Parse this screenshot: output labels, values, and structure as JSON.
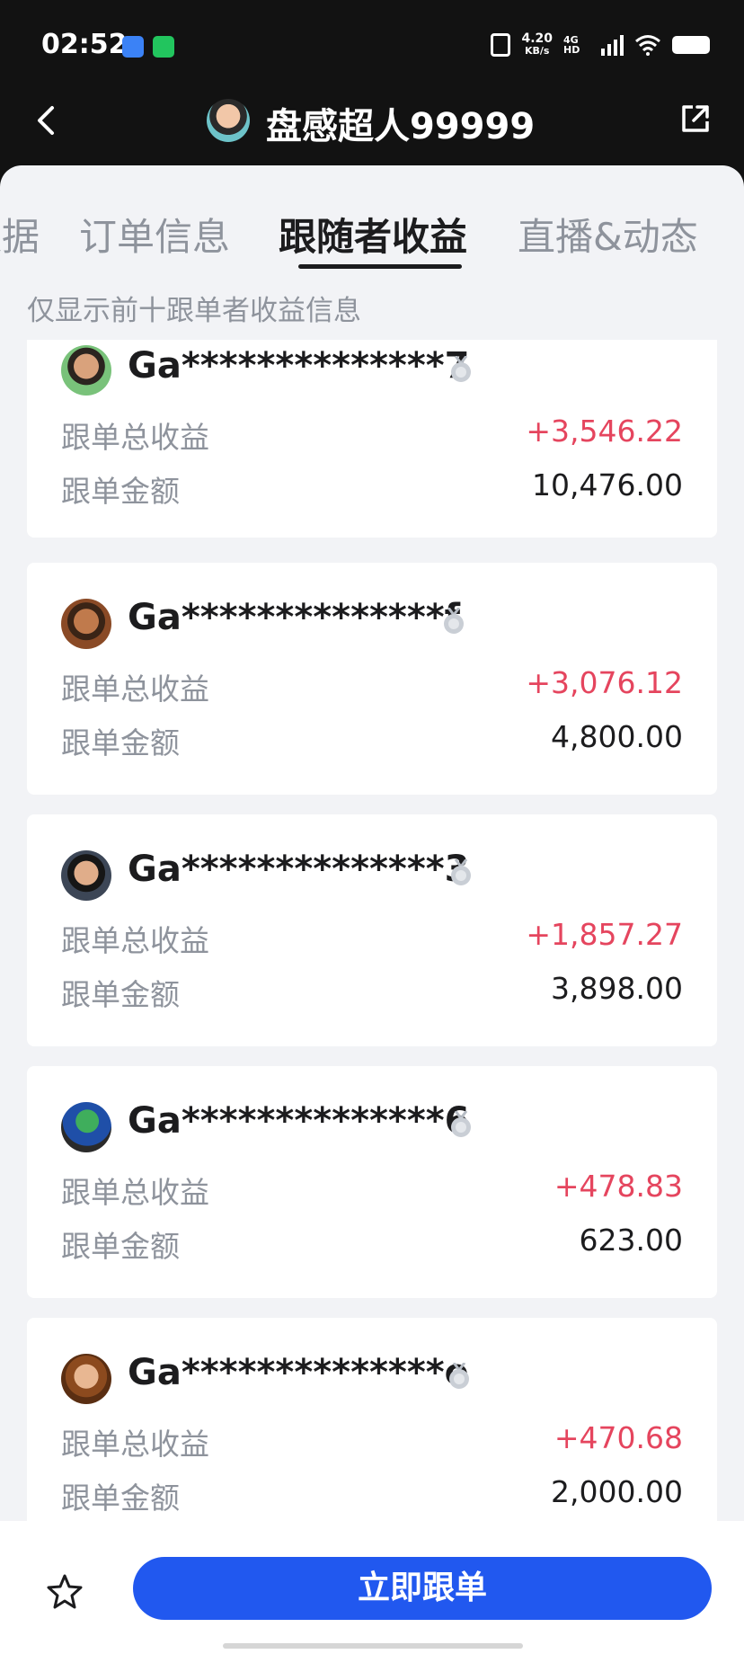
{
  "status_bar": {
    "time": "02:52",
    "net_speed_value": "4.20",
    "net_speed_unit": "KB/s",
    "network": "4G HD"
  },
  "header": {
    "title": "盘感超人99999"
  },
  "tabs": [
    {
      "label": "数据"
    },
    {
      "label": "订单信息"
    },
    {
      "label": "跟随者收益"
    },
    {
      "label": "直播&动态"
    }
  ],
  "subtitle": "仅显示前十跟单者收益信息",
  "row_labels": {
    "total_profit": "跟单总收益",
    "amount": "跟单金额"
  },
  "followers": [
    {
      "name": "Ga**************7",
      "profit": "+3,546.22",
      "amount": "10,476.00"
    },
    {
      "name": "Ga**************f",
      "profit": "+3,076.12",
      "amount": "4,800.00"
    },
    {
      "name": "Ga**************3",
      "profit": "+1,857.27",
      "amount": "3,898.00"
    },
    {
      "name": "Ga**************6",
      "profit": "+478.83",
      "amount": "623.00"
    },
    {
      "name": "Ga**************e",
      "profit": "+470.68",
      "amount": "2,000.00"
    }
  ],
  "bottom_bar": {
    "follow_button_label": "立即跟单"
  },
  "colors": {
    "profit": "#e5455e",
    "accent": "#2158ef"
  },
  "icons": {
    "back": "back-arrow-icon",
    "share": "share-icon",
    "medal": "medal-icon",
    "star": "star-icon"
  }
}
